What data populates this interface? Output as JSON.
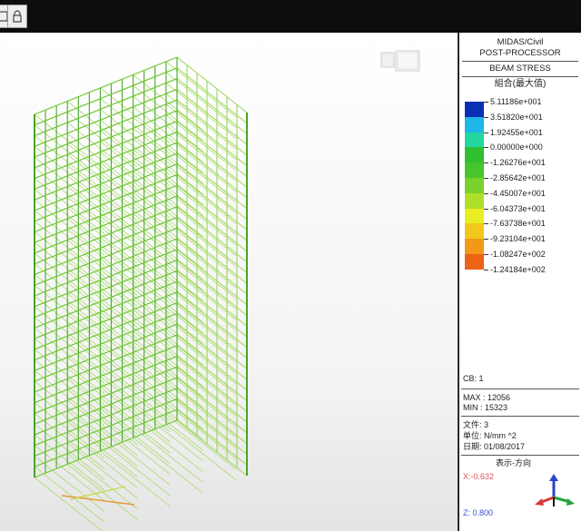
{
  "toolbar": {
    "buttons": [
      {
        "name": "view-icon"
      },
      {
        "name": "lock-icon"
      }
    ]
  },
  "legend": {
    "product": "MIDAS/Civil",
    "module": "POST-PROCESSOR",
    "result_type": "BEAM STRESS",
    "component": "組合(最大值)",
    "colors": [
      "#0a2fb5",
      "#20b6e6",
      "#22d6a0",
      "#2fbf2f",
      "#46c62c",
      "#7bd12b",
      "#aee028",
      "#e8ee22",
      "#f1c81c",
      "#f19a18",
      "#ee6316"
    ],
    "values": [
      "5.11186e+001",
      "3.51820e+001",
      "1.92455e+001",
      "0.00000e+000",
      "-1.26276e+001",
      "-2.85642e+001",
      "-4.45007e+001",
      "-6.04373e+001",
      "-7.63738e+001",
      "-9.23104e+001",
      "-1.08247e+002",
      "-1.24184e+002"
    ],
    "cb": "CB: 1",
    "max": "MAX : 12056",
    "min": "MIN : 15323",
    "file": "文件: 3",
    "unit": "单位: N/mm ^2",
    "date": "日期: 01/08/2017",
    "view_direction": "表示-方向",
    "x_dir": "X:-0.632",
    "z_dir": "Z: 0.800"
  }
}
